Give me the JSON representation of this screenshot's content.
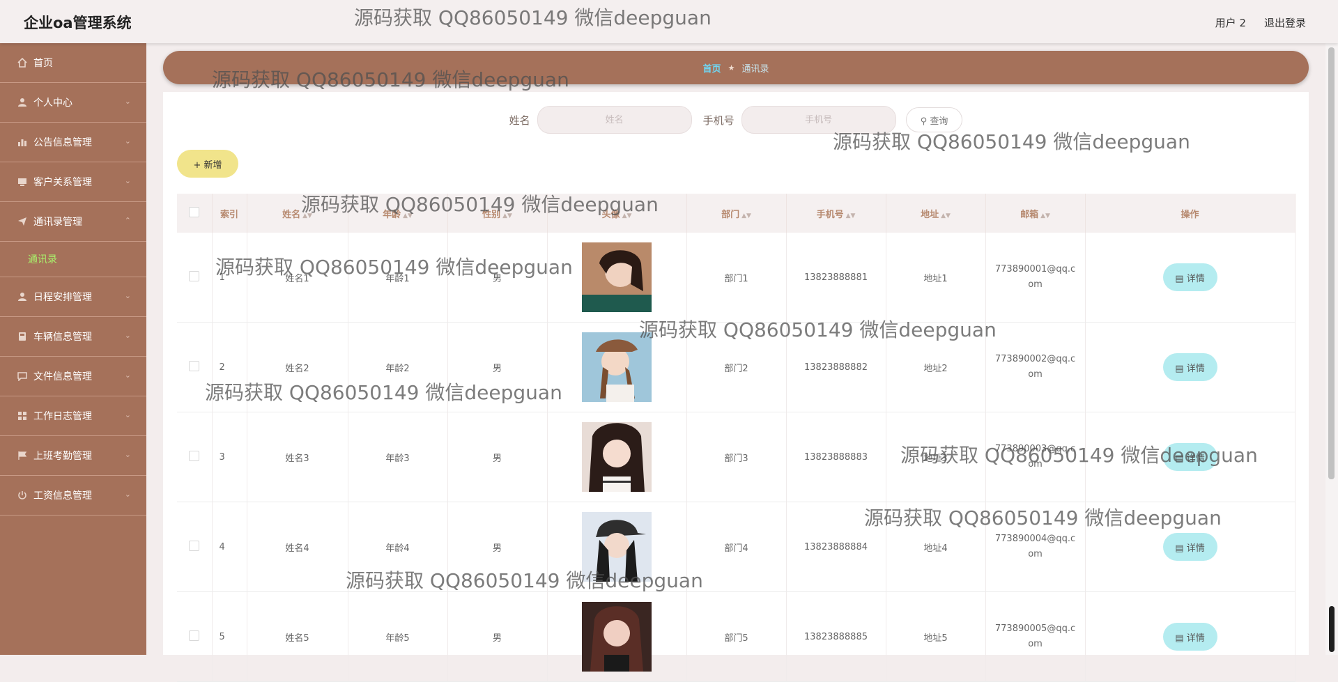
{
  "app": {
    "title": "企业oa管理系统"
  },
  "header": {
    "user": "用户 2",
    "logout": "退出登录"
  },
  "sidebar": {
    "items": [
      {
        "label": "首页",
        "icon": "home-icon"
      },
      {
        "label": "个人中心",
        "icon": "user-icon"
      },
      {
        "label": "公告信息管理",
        "icon": "bar-chart-icon"
      },
      {
        "label": "客户关系管理",
        "icon": "monitor-icon"
      },
      {
        "label": "通讯录管理",
        "icon": "send-icon",
        "expanded": true,
        "children": [
          {
            "label": "通讯录",
            "active": true
          }
        ]
      },
      {
        "label": "日程安排管理",
        "icon": "user-icon"
      },
      {
        "label": "车辆信息管理",
        "icon": "car-icon"
      },
      {
        "label": "文件信息管理",
        "icon": "chat-icon"
      },
      {
        "label": "工作日志管理",
        "icon": "grid-icon"
      },
      {
        "label": "上班考勤管理",
        "icon": "flag-icon"
      },
      {
        "label": "工资信息管理",
        "icon": "power-icon"
      }
    ]
  },
  "breadcrumb": {
    "home": "首页",
    "separator": "★",
    "current": "通讯录"
  },
  "search": {
    "name_label": "姓名",
    "name_placeholder": "姓名",
    "phone_label": "手机号",
    "phone_placeholder": "手机号",
    "button": "查询"
  },
  "toolbar": {
    "add_label": "新增"
  },
  "table": {
    "headers": [
      "索引",
      "姓名",
      "年龄",
      "性别",
      "头像",
      "部门",
      "手机号",
      "地址",
      "邮箱",
      "操作"
    ],
    "detail_label": "详情",
    "rows": [
      {
        "index": "1",
        "name": "姓名1",
        "age": "年龄1",
        "gender": "男",
        "dept": "部门1",
        "phone": "13823888881",
        "addr": "地址1",
        "email": "773890001@qq.com"
      },
      {
        "index": "2",
        "name": "姓名2",
        "age": "年龄2",
        "gender": "男",
        "dept": "部门2",
        "phone": "13823888882",
        "addr": "地址2",
        "email": "773890002@qq.com"
      },
      {
        "index": "3",
        "name": "姓名3",
        "age": "年龄3",
        "gender": "男",
        "dept": "部门3",
        "phone": "13823888883",
        "addr": "地址3",
        "email": "773890003@qq.com"
      },
      {
        "index": "4",
        "name": "姓名4",
        "age": "年龄4",
        "gender": "男",
        "dept": "部门4",
        "phone": "13823888884",
        "addr": "地址4",
        "email": "773890004@qq.com"
      },
      {
        "index": "5",
        "name": "姓名5",
        "age": "年龄5",
        "gender": "男",
        "dept": "部门5",
        "phone": "13823888885",
        "addr": "地址5",
        "email": "773890005@qq.com"
      }
    ]
  },
  "watermark": "源码获取 QQ86050149 微信deepguan",
  "colors": {
    "sidebar": "#a5715a",
    "accent_active": "#a9f06b",
    "breadcrumb_home": "#6fd8f5",
    "add_button": "#f1e48b",
    "detail_button": "#b4ecf0"
  }
}
